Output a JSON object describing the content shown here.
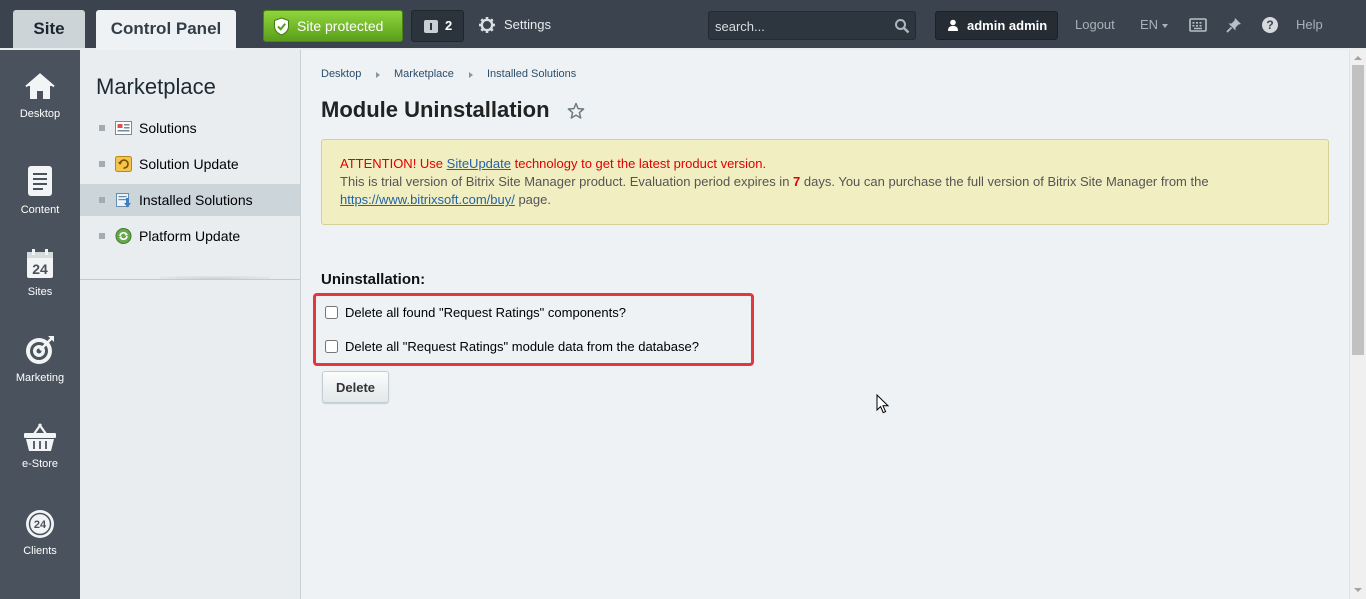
{
  "topbar": {
    "site_tab": "Site",
    "control_panel_tab": "Control Panel",
    "protected_label": "Site protected",
    "notifications_count": "2",
    "settings_label": "Settings",
    "search_placeholder": "search...",
    "user_label": "admin admin",
    "logout_label": "Logout",
    "language": "EN",
    "help_label": "Help"
  },
  "leftnav": {
    "items": [
      {
        "label": "Desktop",
        "icon": "home-icon"
      },
      {
        "label": "Content",
        "icon": "document-icon"
      },
      {
        "label": "Sites",
        "icon": "calendar-24-icon",
        "badge": "24"
      },
      {
        "label": "Marketing",
        "icon": "target-icon"
      },
      {
        "label": "e-Store",
        "icon": "basket-icon"
      },
      {
        "label": "Clients",
        "icon": "clients-24-icon",
        "badge": "24"
      }
    ]
  },
  "submenu": {
    "title": "Marketplace",
    "items": [
      {
        "label": "Solutions"
      },
      {
        "label": "Solution Update"
      },
      {
        "label": "Installed Solutions",
        "active": true
      },
      {
        "label": "Platform Update"
      }
    ]
  },
  "breadcrumb": [
    "Desktop",
    "Installed Solutions",
    "Marketplace"
  ],
  "main": {
    "breadcrumb": [
      "Desktop",
      "Marketplace",
      "Installed Solutions"
    ],
    "title": "Module Uninstallation",
    "alert": {
      "attention_prefix": "ATTENTION! Use ",
      "siteupdate_link": "SiteUpdate",
      "attention_suffix": " technology to get the latest product version.",
      "trial_prefix": "This is trial version of Bitrix Site Manager product. Evaluation period expires in ",
      "days": "7",
      "trial_suffix": " days. You can purchase the full version of Bitrix Site Manager from the",
      "buy_link": "https://www.bitrixsoft.com/buy/",
      "buy_suffix": " page."
    },
    "section_title": "Uninstallation:",
    "options": [
      {
        "label": "Delete all found \"Request Ratings\" components?",
        "checked": false
      },
      {
        "label": "Delete all \"Request Ratings\" module data from the database?",
        "checked": false
      }
    ],
    "delete_label": "Delete"
  },
  "colors": {
    "topbar_bg": "#3b444e",
    "protected_green": "#6db82a",
    "alert_bg": "#f1eec2",
    "alert_red": "#e00000",
    "link_blue": "#2463a5",
    "highlight_red": "#e0383e"
  }
}
